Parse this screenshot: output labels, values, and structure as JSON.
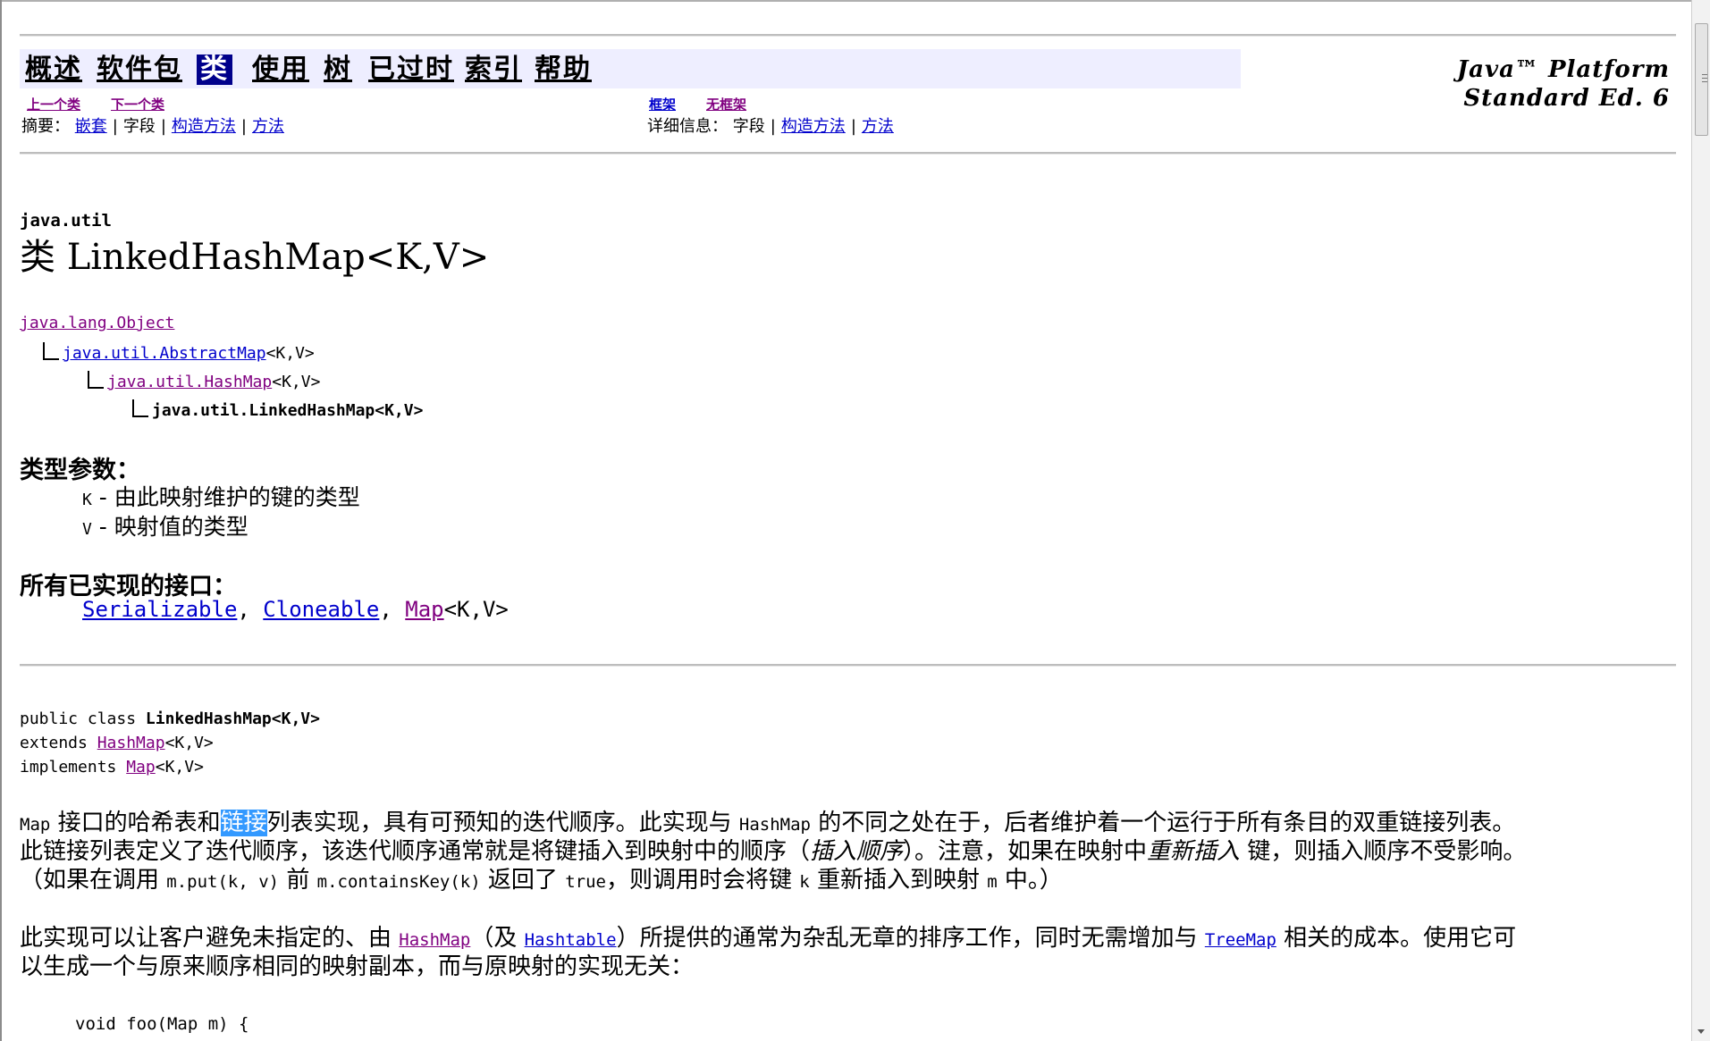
{
  "nav": {
    "items": [
      {
        "label": "概述"
      },
      {
        "label": "软件包"
      },
      {
        "label": "类"
      },
      {
        "label": "使用"
      },
      {
        "label": "树"
      },
      {
        "label": "已过时"
      },
      {
        "label": "索引"
      },
      {
        "label": "帮助"
      }
    ],
    "active_index": 2,
    "brand_line1": "Java™ Platform",
    "brand_line2": "Standard Ed. 6",
    "prev_class": "上一个类",
    "next_class": "下一个类",
    "frames": "框架",
    "no_frames": "无框架",
    "summary_label": "摘要：",
    "summary_nested": "嵌套",
    "summary_field": "字段",
    "summary_constructor": "构造方法",
    "summary_method": "方法",
    "detail_label": "详细信息：",
    "detail_field": "字段",
    "detail_constructor": "构造方法",
    "detail_method": "方法"
  },
  "header": {
    "package": "java.util",
    "class_title": "类 LinkedHashMap<K,V>"
  },
  "hierarchy": [
    {
      "text": "java.lang.Object",
      "suffix": ""
    },
    {
      "text": "java.util.AbstractMap",
      "suffix": "<K,V>"
    },
    {
      "text": "java.util.HashMap",
      "suffix": "<K,V>"
    },
    {
      "text": "java.util.LinkedHashMap<K,V>",
      "suffix": ""
    }
  ],
  "type_params": {
    "heading": "类型参数：",
    "items": [
      {
        "name": "K",
        "desc": " - 由此映射维护的键的类型"
      },
      {
        "name": "V",
        "desc": " - 映射值的类型"
      }
    ]
  },
  "interfaces": {
    "heading": "所有已实现的接口：",
    "items": [
      "Serializable",
      "Cloneable",
      "Map"
    ],
    "map_suffix": "<K,V>"
  },
  "declaration": {
    "line1_prefix": "public class ",
    "line1_name": "LinkedHashMap<K,V>",
    "line2_prefix": "extends ",
    "line2_link": "HashMap",
    "line2_suffix": "<K,V>",
    "line3_prefix": "implements ",
    "line3_link": "Map",
    "line3_suffix": "<K,V>"
  },
  "description": {
    "p1_a": "Map",
    "p1_b": " 接口的哈希表和",
    "p1_sel": "链接",
    "p1_c": "列表实现，具有可预知的迭代顺序。此实现与 ",
    "p1_d": "HashMap",
    "p1_e": " 的不同之处在于，后者维护着一个运行于所有条目的双重链接列表。",
    "p1_line2_a": "此链接列表定义了迭代顺序，该迭代顺序通常就是将键插入到映射中的顺序（",
    "p1_line2_em": "插入顺序",
    "p1_line2_b": "）。注意，如果在映射中",
    "p1_line2_em2": "重新插入",
    "p1_line2_c": " 键，则插入顺序不受影响。",
    "p1_line3_a": "（如果在调用 ",
    "p1_line3_code1": "m.put(k, v)",
    "p1_line3_b": " 前 ",
    "p1_line3_code2": "m.containsKey(k)",
    "p1_line3_c": " 返回了 ",
    "p1_line3_code3": "true",
    "p1_line3_d": "，则调用时会将键 ",
    "p1_line3_code4": "k",
    "p1_line3_e": " 重新插入到映射 ",
    "p1_line3_code5": "m",
    "p1_line3_f": " 中。）",
    "p2_a": "此实现可以让客户避免未指定的、由 ",
    "p2_link1": "HashMap",
    "p2_b": "（及 ",
    "p2_link2": "Hashtable",
    "p2_c": "）所提供的通常为杂乱无章的排序工作，同时无需增加与 ",
    "p2_link3": "TreeMap",
    "p2_d": " 相关的成本。使用它可",
    "p2_line2": "以生成一个与原来顺序相同的映射副本，而与原映射的实现无关：",
    "code_line": "void foo(Map m) {"
  }
}
